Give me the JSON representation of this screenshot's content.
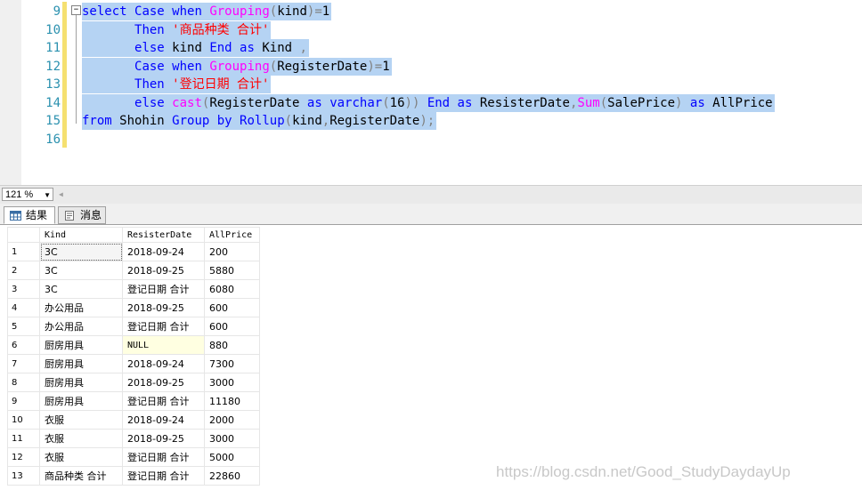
{
  "editor": {
    "line_numbers": [
      "9",
      "10",
      "11",
      "12",
      "13",
      "14",
      "15",
      "16"
    ],
    "lines": [
      [
        {
          "t": "select",
          "c": "k"
        },
        {
          "t": " ",
          "c": "t"
        },
        {
          "t": "Case",
          "c": "k"
        },
        {
          "t": " ",
          "c": "t"
        },
        {
          "t": "when",
          "c": "k"
        },
        {
          "t": " ",
          "c": "t"
        },
        {
          "t": "Grouping",
          "c": "f"
        },
        {
          "t": "(",
          "c": "g"
        },
        {
          "t": "kind",
          "c": "t"
        },
        {
          "t": ")=",
          "c": "g"
        },
        {
          "t": "1",
          "c": "t"
        }
      ],
      [
        {
          "t": "       ",
          "c": "t"
        },
        {
          "t": "Then",
          "c": "k"
        },
        {
          "t": " ",
          "c": "t"
        },
        {
          "t": "'商品种类 合计'",
          "c": "s"
        }
      ],
      [
        {
          "t": "       ",
          "c": "t"
        },
        {
          "t": "else",
          "c": "k"
        },
        {
          "t": " kind ",
          "c": "t"
        },
        {
          "t": "End",
          "c": "k"
        },
        {
          "t": " ",
          "c": "t"
        },
        {
          "t": "as",
          "c": "k"
        },
        {
          "t": " Kind ",
          "c": "t"
        },
        {
          "t": ",",
          "c": "g"
        }
      ],
      [
        {
          "t": "       ",
          "c": "t"
        },
        {
          "t": "Case",
          "c": "k"
        },
        {
          "t": " ",
          "c": "t"
        },
        {
          "t": "when",
          "c": "k"
        },
        {
          "t": " ",
          "c": "t"
        },
        {
          "t": "Grouping",
          "c": "f"
        },
        {
          "t": "(",
          "c": "g"
        },
        {
          "t": "RegisterDate",
          "c": "t"
        },
        {
          "t": ")=",
          "c": "g"
        },
        {
          "t": "1",
          "c": "t"
        }
      ],
      [
        {
          "t": "       ",
          "c": "t"
        },
        {
          "t": "Then",
          "c": "k"
        },
        {
          "t": " ",
          "c": "t"
        },
        {
          "t": "'登记日期 合计'",
          "c": "s"
        }
      ],
      [
        {
          "t": "       ",
          "c": "t"
        },
        {
          "t": "else",
          "c": "k"
        },
        {
          "t": " ",
          "c": "t"
        },
        {
          "t": "cast",
          "c": "f"
        },
        {
          "t": "(",
          "c": "g"
        },
        {
          "t": "RegisterDate ",
          "c": "t"
        },
        {
          "t": "as",
          "c": "k"
        },
        {
          "t": " ",
          "c": "t"
        },
        {
          "t": "varchar",
          "c": "k"
        },
        {
          "t": "(",
          "c": "g"
        },
        {
          "t": "16",
          "c": "t"
        },
        {
          "t": "))",
          "c": "g"
        },
        {
          "t": " ",
          "c": "t"
        },
        {
          "t": "End",
          "c": "k"
        },
        {
          "t": " ",
          "c": "t"
        },
        {
          "t": "as",
          "c": "k"
        },
        {
          "t": " ResisterDate",
          "c": "t"
        },
        {
          "t": ",",
          "c": "g"
        },
        {
          "t": "Sum",
          "c": "f"
        },
        {
          "t": "(",
          "c": "g"
        },
        {
          "t": "SalePrice",
          "c": "t"
        },
        {
          "t": ")",
          "c": "g"
        },
        {
          "t": " ",
          "c": "t"
        },
        {
          "t": "as",
          "c": "k"
        },
        {
          "t": " AllPrice",
          "c": "t"
        }
      ],
      [
        {
          "t": "from",
          "c": "k"
        },
        {
          "t": " Shohin ",
          "c": "t"
        },
        {
          "t": "Group",
          "c": "k"
        },
        {
          "t": " ",
          "c": "t"
        },
        {
          "t": "by",
          "c": "k"
        },
        {
          "t": " ",
          "c": "t"
        },
        {
          "t": "Rollup",
          "c": "k"
        },
        {
          "t": "(",
          "c": "g"
        },
        {
          "t": "kind",
          "c": "t"
        },
        {
          "t": ",",
          "c": "g"
        },
        {
          "t": "RegisterDate",
          "c": "t"
        },
        {
          "t": ");",
          "c": "g"
        }
      ],
      []
    ]
  },
  "zoom": {
    "level": "121 %"
  },
  "tabs": {
    "results": "结果",
    "messages": "消息"
  },
  "grid": {
    "headers": [
      "Kind",
      "ResisterDate",
      "AllPrice"
    ],
    "rows": [
      [
        "1",
        "3C",
        "2018-09-24",
        "200"
      ],
      [
        "2",
        "3C",
        "2018-09-25",
        "5880"
      ],
      [
        "3",
        "3C",
        "登记日期 合计",
        "6080"
      ],
      [
        "4",
        "办公用品",
        "2018-09-25",
        "600"
      ],
      [
        "5",
        "办公用品",
        "登记日期 合计",
        "600"
      ],
      [
        "6",
        "厨房用具",
        "NULL",
        "880"
      ],
      [
        "7",
        "厨房用具",
        "2018-09-24",
        "7300"
      ],
      [
        "8",
        "厨房用具",
        "2018-09-25",
        "3000"
      ],
      [
        "9",
        "厨房用具",
        "登记日期 合计",
        "11180"
      ],
      [
        "10",
        "衣服",
        "2018-09-24",
        "2000"
      ],
      [
        "11",
        "衣服",
        "2018-09-25",
        "3000"
      ],
      [
        "12",
        "衣服",
        "登记日期 合计",
        "5000"
      ],
      [
        "13",
        "商品种类 合计",
        "登记日期 合计",
        "22860"
      ]
    ]
  },
  "watermark": "https://blog.csdn.net/Good_StudyDaydayUp"
}
